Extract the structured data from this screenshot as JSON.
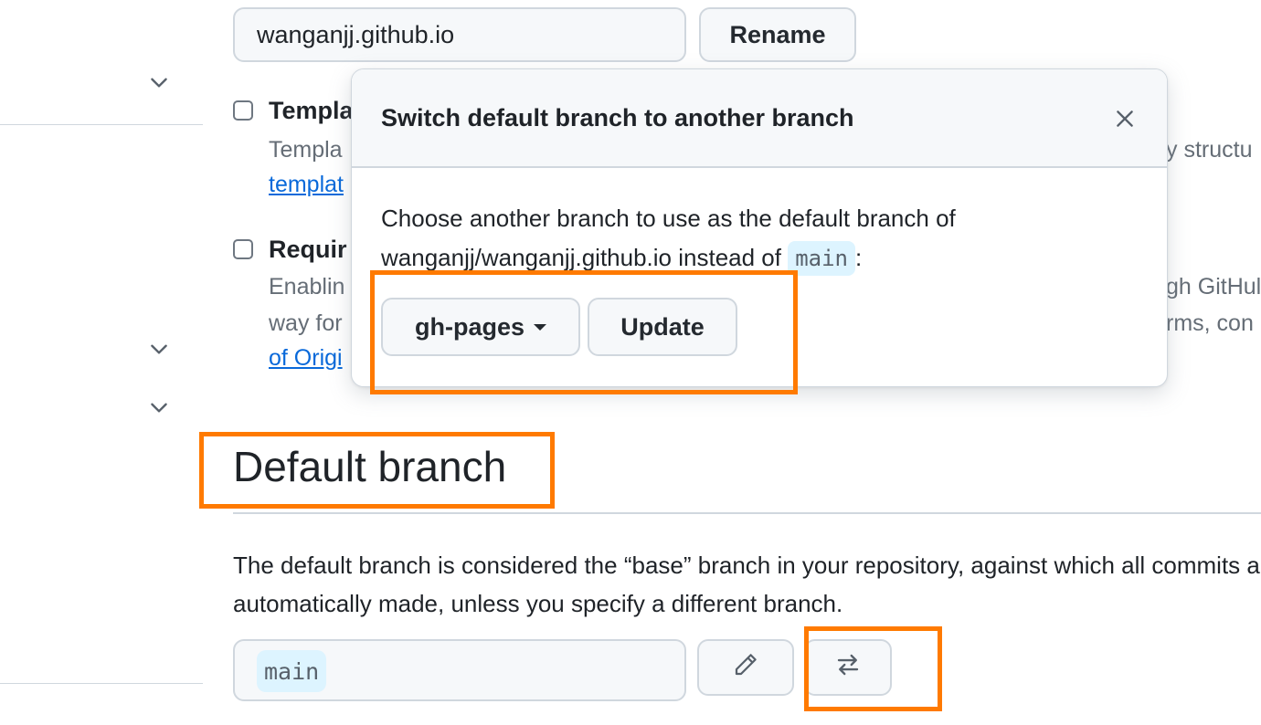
{
  "repo": {
    "name_value": "wanganjj.github.io",
    "rename_label": "Rename"
  },
  "template_option": {
    "title": "Templa",
    "desc_left": "Templa",
    "desc_right": "y structu",
    "link": "templat"
  },
  "require_option": {
    "title": "Requir",
    "desc_line1_left": "Enablin",
    "desc_line1_right": "gh GitHul",
    "desc_line2_left": "way for",
    "desc_line2_right": "rms, con",
    "link": "of Origi"
  },
  "default_branch": {
    "heading": "Default branch",
    "description": "The default branch is considered the “base” branch in your repository, against which all commits are automatically made, unless you specify a different branch.",
    "current_branch": "main"
  },
  "dialog": {
    "title": "Switch default branch to another branch",
    "body_prefix": "Choose another branch to use as the default branch of wanganjj/wanganjj.github.io instead of ",
    "current_branch": "main",
    "body_suffix": ":",
    "selected_branch": "gh-pages",
    "update_label": "Update"
  },
  "colors": {
    "highlight": "#ff7a00",
    "link": "#0969da",
    "code_background": "#ddf4ff"
  }
}
